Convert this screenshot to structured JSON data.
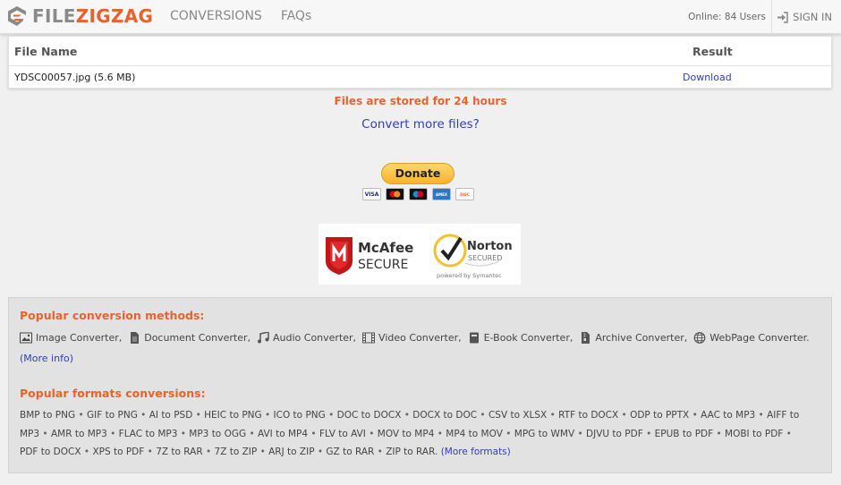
{
  "header": {
    "logo_part1": "FILE",
    "logo_part2": "ZIGZAG",
    "nav": [
      "CONVERSIONS",
      "FAQs"
    ],
    "online": "Online: 84 Users",
    "sign_in": "SIGN IN"
  },
  "table": {
    "col_file": "File Name",
    "col_result": "Result",
    "row": {
      "file": "YDSC00057.jpg (5.6 MB)",
      "result": "Download"
    }
  },
  "stored_notice": "Files are stored for 24 hours",
  "convert_more": "Convert more files?",
  "donate": {
    "label": "Donate",
    "cards": [
      "VISA",
      "MASTERCARD",
      "MAESTRO",
      "AMEX",
      "DISCOVER"
    ]
  },
  "badges": {
    "mcafee_line1": "McAfee",
    "mcafee_line2": "SECURE",
    "norton_line1": "Norton",
    "norton_line2": "SECURED",
    "norton_line3": "powered by Symantec"
  },
  "popular": {
    "methods_heading": "Popular conversion methods:",
    "methods": [
      {
        "label": "Image Converter,",
        "icon": "image-icon"
      },
      {
        "label": "Document Converter,",
        "icon": "document-icon"
      },
      {
        "label": "Audio Converter,",
        "icon": "music-icon"
      },
      {
        "label": "Video Converter,",
        "icon": "film-icon"
      },
      {
        "label": "E-Book Converter,",
        "icon": "book-icon"
      },
      {
        "label": "Archive Converter,",
        "icon": "archive-icon"
      },
      {
        "label": "WebPage Converter.",
        "icon": "globe-icon"
      }
    ],
    "more_info": "(More info)",
    "formats_heading": "Popular formats conversions:",
    "formats": [
      "BMP to PNG",
      "GIF to PNG",
      "AI to PSD",
      "HEIC to PNG",
      "ICO to PNG",
      "DOC to DOCX",
      "DOCX to DOC",
      "CSV to XLSX",
      "RTF to DOCX",
      "ODP to PPTX",
      "AAC to MP3",
      "AIFF to MP3",
      "AMR to MP3",
      "FLAC to MP3",
      "MP3 to OGG",
      "AVI to MP4",
      "FLV to AVI",
      "MOV to MP4",
      "MP4 to MOV",
      "MPG to WMV",
      "DJVU to PDF",
      "EPUB to PDF",
      "MOBI to PDF",
      "PDF to DOCX",
      "XPS to PDF",
      "7Z to RAR",
      "7Z to ZIP",
      "ARJ to ZIP",
      "GZ to RAR",
      "ZIP to RAR."
    ],
    "more_formats": "(More formats)"
  }
}
